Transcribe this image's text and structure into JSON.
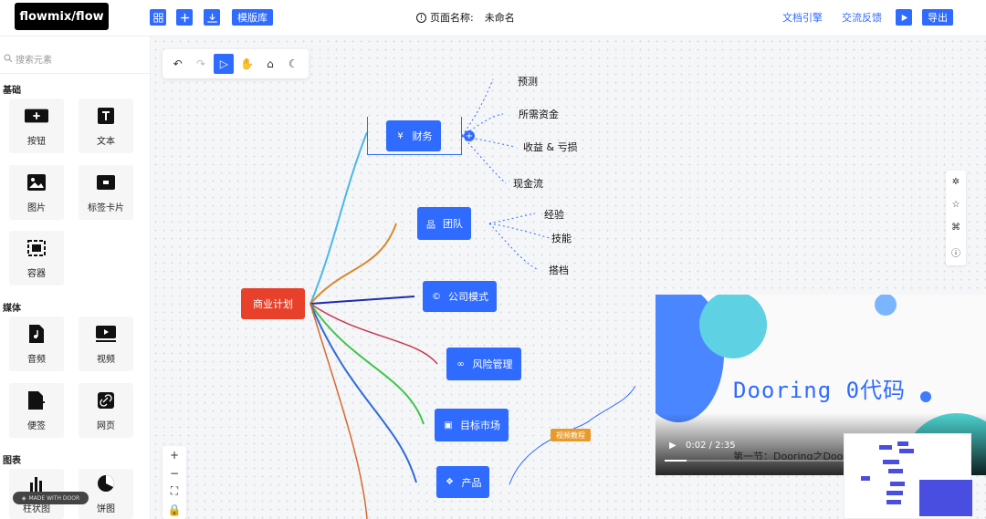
{
  "header": {
    "logo": "flowmix/flow",
    "template_label": "模版库",
    "page_name_label": "页面名称:",
    "page_name_value": "未命名",
    "docs_link": "文档引擎",
    "feedback_link": "交流反馈",
    "export_label": "导出"
  },
  "sidebar": {
    "search_placeholder": "搜索元素",
    "sections": {
      "basic": "基础",
      "media": "媒体",
      "chart": "图表"
    },
    "items": [
      {
        "label": "按钮",
        "icon": "button-icon"
      },
      {
        "label": "文本",
        "icon": "text-icon"
      },
      {
        "label": "图片",
        "icon": "image-icon"
      },
      {
        "label": "标签卡片",
        "icon": "tag-card-icon"
      },
      {
        "label": "容器",
        "icon": "container-icon"
      },
      {
        "label": "音频",
        "icon": "audio-icon"
      },
      {
        "label": "视频",
        "icon": "video-icon"
      },
      {
        "label": "便签",
        "icon": "note-icon"
      },
      {
        "label": "网页",
        "icon": "webpage-icon"
      },
      {
        "label": "柱状图",
        "icon": "bar-chart-icon"
      },
      {
        "label": "饼图",
        "icon": "pie-chart-icon"
      }
    ],
    "made_with": "MADE WITH DOOR"
  },
  "mindmap": {
    "root": "商业计划",
    "branches": [
      {
        "label": "财务",
        "icon": "money-icon"
      },
      {
        "label": "团队",
        "icon": "team-icon"
      },
      {
        "label": "公司模式",
        "icon": "company-icon"
      },
      {
        "label": "风险管理",
        "icon": "risk-icon"
      },
      {
        "label": "目标市场",
        "icon": "market-icon"
      },
      {
        "label": "产品",
        "icon": "product-icon"
      }
    ],
    "finance_children": [
      "预测",
      "所需资金",
      "收益 & 亏损",
      "现金流"
    ],
    "team_children": [
      "经验",
      "技能",
      "搭档"
    ],
    "tag_label": "视频教程"
  },
  "video": {
    "banner": "Dooring 0代码",
    "time": "0:02 / 2:35",
    "caption": "第一节：Dooring之Dooring",
    "progress": 0.12
  },
  "colors": {
    "accent": "#2f6bff",
    "root": "#e8412b",
    "tag": "#e79b2a"
  }
}
